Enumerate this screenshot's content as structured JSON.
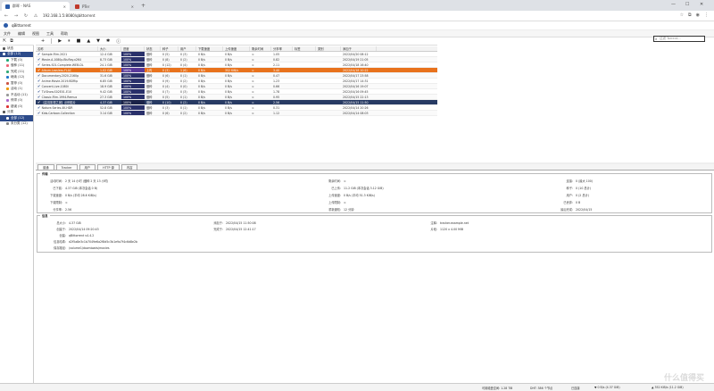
{
  "browser": {
    "tabs": [
      {
        "label": "群晖 - NAS",
        "active": true,
        "color": "#2b5ba8"
      },
      {
        "label": "PTer",
        "active": false,
        "color": "#c0392b"
      }
    ],
    "url": "192.168.1.5:8080/qbittorrent",
    "new_tab": "+",
    "win_min": "—",
    "win_max": "☐",
    "win_close": "✕"
  },
  "app": {
    "name": "qBittorrent",
    "menu": [
      "文件",
      "编辑",
      "视图",
      "工具",
      "帮助"
    ],
    "search_placeholder": "过滤 Torrent..."
  },
  "sidebar": {
    "items": [
      {
        "label": "状态",
        "selected": false,
        "sub": false,
        "color": "#555"
      },
      {
        "label": "全部 (12)",
        "selected": true,
        "sub": false,
        "color": "#fff"
      },
      {
        "label": "下载 (0)",
        "selected": false,
        "sub": true,
        "color": "#2a7"
      },
      {
        "label": "做种 (11)",
        "selected": false,
        "sub": true,
        "color": "#e67"
      },
      {
        "label": "完成 (11)",
        "selected": false,
        "sub": true,
        "color": "#3a7"
      },
      {
        "label": "继续 (12)",
        "selected": false,
        "sub": true,
        "color": "#27c"
      },
      {
        "label": "暂停 (0)",
        "selected": false,
        "sub": true,
        "color": "#c54"
      },
      {
        "label": "活动 (1)",
        "selected": false,
        "sub": true,
        "color": "#e90"
      },
      {
        "label": "不活动 (11)",
        "selected": false,
        "sub": true,
        "color": "#999"
      },
      {
        "label": "停滞 (0)",
        "selected": false,
        "sub": true,
        "color": "#a6c"
      },
      {
        "label": "错误 (0)",
        "selected": false,
        "sub": true,
        "color": "#d33"
      },
      {
        "label": "分类",
        "selected": false,
        "sub": false,
        "color": "#555"
      },
      {
        "label": "全部 (12)",
        "selected": true,
        "sub": true,
        "color": "#fff"
      },
      {
        "label": "未分类 (12)",
        "selected": false,
        "sub": true,
        "color": "#888"
      }
    ]
  },
  "toolbar": {
    "add_icon": "+",
    "play_icon": "▶",
    "pause_icon": "⏸",
    "delete_icon": "■",
    "up_icon": "▲",
    "down_icon": "▼",
    "settings_icon": "✱",
    "info_icon": "ⓘ"
  },
  "table": {
    "columns": [
      "名称",
      "大小",
      "进度",
      "状态",
      "种子",
      "用户",
      "下载速度",
      "上传速度",
      "剩余时间",
      "分享率",
      "标签",
      "类别",
      "添加于"
    ],
    "rows": [
      {
        "name": "Sample.Film.2021",
        "size": "12.4 GiB",
        "progress": "100%",
        "status": "做种",
        "seeds": "0 (5)",
        "peers": "0 (3)",
        "down": "0 B/s",
        "up": "0 B/s",
        "eta": "∞",
        "ratio": "1.05",
        "tag": "",
        "cat": "",
        "added": "2022/04/20 08:12",
        "style": "normal"
      },
      {
        "name": "Movie.A.1080p.BluRay.x264",
        "size": "8.73 GiB",
        "progress": "100%",
        "status": "做种",
        "seeds": "0 (8)",
        "peers": "0 (2)",
        "down": "0 B/s",
        "up": "0 B/s",
        "eta": "∞",
        "ratio": "0.82",
        "tag": "",
        "cat": "",
        "added": "2022/04/19 21:05",
        "style": "alt"
      },
      {
        "name": "Series.S01.Complete.WEB-DL",
        "size": "24.1 GiB",
        "progress": "100%",
        "status": "做种",
        "seeds": "0 (12)",
        "peers": "0 (4)",
        "down": "0 B/s",
        "up": "0 B/s",
        "eta": "∞",
        "ratio": "2.11",
        "tag": "",
        "cat": "",
        "added": "2022/04/18 16:40",
        "style": "normal"
      },
      {
        "name": "Album.Lossless.FLAC",
        "size": "1.02 GiB",
        "progress": "100%",
        "status": "上传",
        "seeds": "0 (3)",
        "peers": "1 (6)",
        "down": "0 B/s",
        "up": "352 KiB/s",
        "eta": "∞",
        "ratio": "3.40",
        "tag": "",
        "cat": "",
        "added": "2022/04/18 10:22",
        "style": "orange"
      },
      {
        "name": "Documentary.2020.2160p",
        "size": "31.6 GiB",
        "progress": "100%",
        "status": "做种",
        "seeds": "0 (6)",
        "peers": "0 (1)",
        "down": "0 B/s",
        "up": "0 B/s",
        "eta": "∞",
        "ratio": "0.47",
        "tag": "",
        "cat": "",
        "added": "2022/04/17 23:58",
        "style": "alt"
      },
      {
        "name": "Anime.Movie.2019.BDRip",
        "size": "6.85 GiB",
        "progress": "100%",
        "status": "做种",
        "seeds": "0 (9)",
        "peers": "0 (2)",
        "down": "0 B/s",
        "up": "0 B/s",
        "eta": "∞",
        "ratio": "1.23",
        "tag": "",
        "cat": "",
        "added": "2022/04/17 14:31",
        "style": "normal"
      },
      {
        "name": "Concert.Live.1080i",
        "size": "18.9 GiB",
        "progress": "100%",
        "status": "做种",
        "seeds": "0 (4)",
        "peers": "0 (0)",
        "down": "0 B/s",
        "up": "0 B/s",
        "eta": "∞",
        "ratio": "0.66",
        "tag": "",
        "cat": "",
        "added": "2022/04/16 19:07",
        "style": "alt"
      },
      {
        "name": "TV.Show.S02E01-E10",
        "size": "9.42 GiB",
        "progress": "100%",
        "status": "做种",
        "seeds": "0 (7)",
        "peers": "0 (3)",
        "down": "0 B/s",
        "up": "0 B/s",
        "eta": "∞",
        "ratio": "1.78",
        "tag": "",
        "cat": "",
        "added": "2022/04/16 09:45",
        "style": "normal"
      },
      {
        "name": "Classic.Film.1994.Remux",
        "size": "27.3 GiB",
        "progress": "100%",
        "status": "做种",
        "seeds": "0 (5)",
        "peers": "0 (1)",
        "down": "0 B/s",
        "up": "0 B/s",
        "eta": "∞",
        "ratio": "0.95",
        "tag": "",
        "cat": "",
        "added": "2022/04/15 22:13",
        "style": "alt"
      },
      {
        "name": "【高清影视之家】示例影片",
        "size": "4.37 GiB",
        "progress": "100%",
        "status": "做种",
        "seeds": "0 (10)",
        "peers": "0 (2)",
        "down": "0 B/s",
        "up": "0 B/s",
        "eta": "∞",
        "ratio": "2.56",
        "tag": "",
        "cat": "",
        "added": "2022/04/15 11:50",
        "style": "dark"
      },
      {
        "name": "Nature.Series.4K.HDR",
        "size": "52.8 GiB",
        "progress": "100%",
        "status": "做种",
        "seeds": "0 (3)",
        "peers": "0 (1)",
        "down": "0 B/s",
        "up": "0 B/s",
        "eta": "∞",
        "ratio": "0.31",
        "tag": "",
        "cat": "",
        "added": "2022/04/14 20:26",
        "style": "normal"
      },
      {
        "name": "Kids.Cartoon.Collection",
        "size": "3.14 GiB",
        "progress": "100%",
        "status": "做种",
        "seeds": "0 (6)",
        "peers": "0 (2)",
        "down": "0 B/s",
        "up": "0 B/s",
        "eta": "∞",
        "ratio": "1.12",
        "tag": "",
        "cat": "",
        "added": "2022/04/14 08:03",
        "style": "alt"
      }
    ]
  },
  "details": {
    "tabs": [
      "普通",
      "Tracker",
      "用户",
      "HTTP 源",
      "内容"
    ],
    "transfer_title": "传输",
    "transfer": [
      {
        "k": "活动时间:",
        "v": "2 天 14 小时 (做种 2 天 13 小时)"
      },
      {
        "k": "已下载:",
        "v": "4.37 GiB (本次会话 0 B)"
      },
      {
        "k": "下载速度:",
        "v": "0 B/s (平均 28.6 KiB/s)"
      },
      {
        "k": "下载限制:",
        "v": "∞"
      },
      {
        "k": "分享率:",
        "v": "2.56"
      },
      {
        "k": "剩余时间:",
        "v": "∞"
      },
      {
        "k": "已上传:",
        "v": "11.2 GiB (本次会话 3.12 GiB)"
      },
      {
        "k": "上传速度:",
        "v": "0 B/s (平均 51.3 KiB/s)"
      },
      {
        "k": "上传限制:",
        "v": "∞"
      },
      {
        "k": "重新通知:",
        "v": "12 分钟"
      },
      {
        "k": "连接:",
        "v": "0 (最大 100)"
      },
      {
        "k": "种子:",
        "v": "0 (10 总计)"
      },
      {
        "k": "用户:",
        "v": "0 (2 总计)"
      },
      {
        "k": "已丢弃:",
        "v": "0 B"
      },
      {
        "k": "最后完成:",
        "v": "2022/04/15"
      }
    ],
    "info_title": "信息",
    "info": [
      {
        "k": "总大小:",
        "v": "4.37 GiB"
      },
      {
        "k": "添加于:",
        "v": "2022/04/15 11:50:08"
      },
      {
        "k": "注释:",
        "v": "tracker.example.net"
      },
      {
        "k": "创建于:",
        "v": "2022/04/14 09:20:43"
      },
      {
        "k": "完成于:",
        "v": "2022/04/15 12:41:17"
      },
      {
        "k": "片段:",
        "v": "1120 x 4.00 MiB"
      },
      {
        "k": "创建:",
        "v": "qBittorrent v4.4.2"
      },
      {
        "k": "信息哈希:",
        "v": "d2f5a8e3c1b7049e6a2f8d5c3b1e9a7f4c6d8e2b"
      },
      {
        "k": "保存路径:",
        "v": "/volume1/downloads/movies"
      }
    ]
  },
  "statusbar": {
    "dht": "DHT: 386 个节点",
    "down": "▼ 0 B/s (4.37 GiB)",
    "up": "▲ 352 KiB/s (11.2 GiB)",
    "free": "可用磁盘空间: 1.28 TiB",
    "conn": "已连接"
  },
  "watermark": "什么值得买"
}
